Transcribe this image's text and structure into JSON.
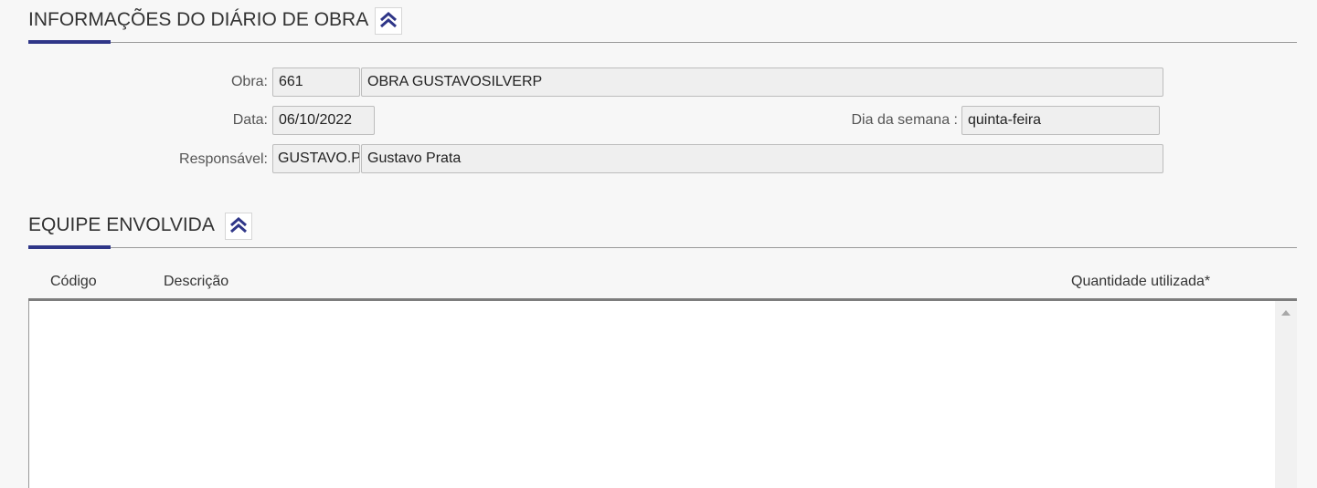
{
  "sections": {
    "info": {
      "title": "INFORMAÇÕES DO DIÁRIO DE OBRA"
    },
    "team": {
      "title": "EQUIPE ENVOLVIDA"
    }
  },
  "form": {
    "obra": {
      "label": "Obra:",
      "code": "661",
      "name": "OBRA GUSTAVOSILVERP"
    },
    "data": {
      "label": "Data:",
      "value": "06/10/2022"
    },
    "dia_semana": {
      "label": "Dia da semana :",
      "value": "quinta-feira"
    },
    "responsavel": {
      "label": "Responsável:",
      "code": "GUSTAVO.PRATA",
      "name": "Gustavo Prata"
    }
  },
  "team_table": {
    "columns": [
      "Código",
      "Descrição",
      "Quantidade utilizada*"
    ],
    "rows": []
  },
  "colors": {
    "accent": "#2f3688",
    "icon": "#2f3688"
  },
  "icons": {
    "collapse": "double-chevron-up-icon",
    "scroll_up": "scroll-up-arrow-icon"
  }
}
